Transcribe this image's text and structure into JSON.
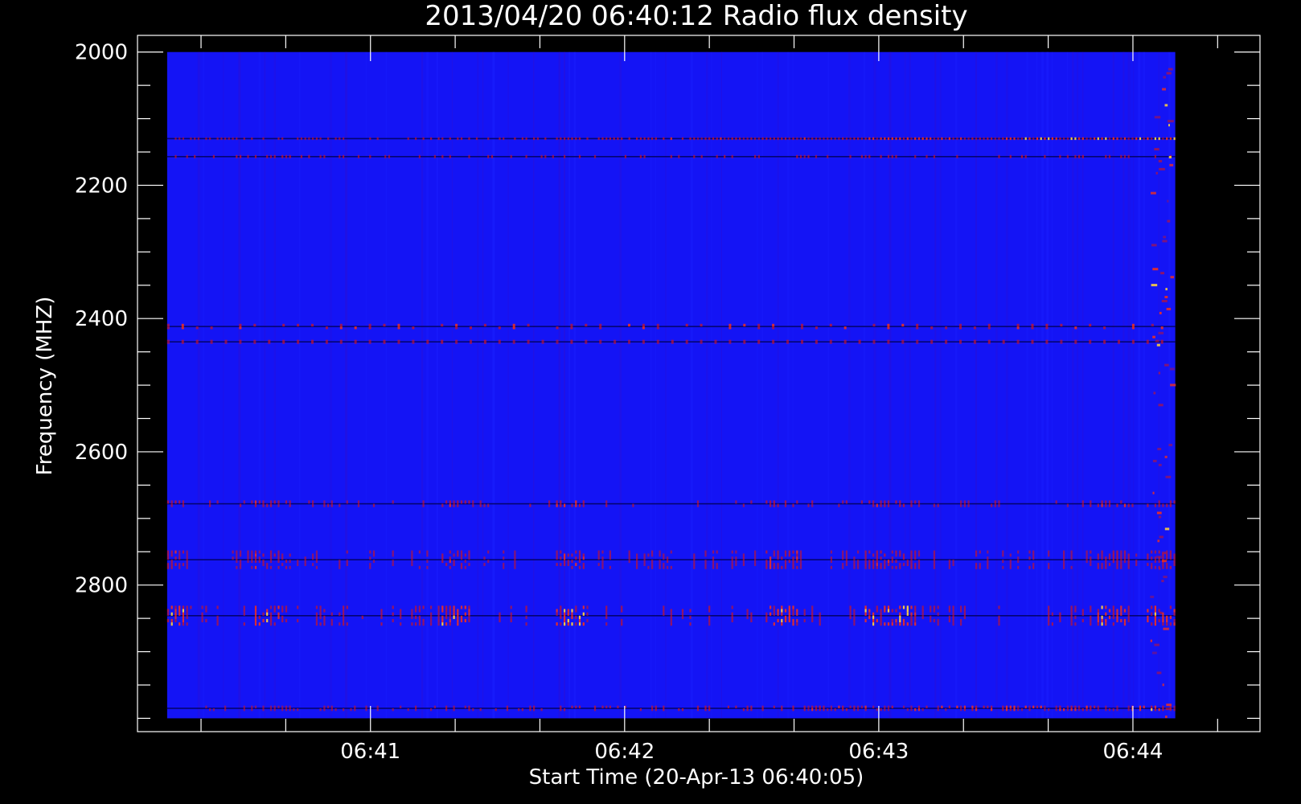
{
  "chart_data": {
    "type": "heatmap",
    "title": "2013/04/20 06:40:12 Radio flux density",
    "xlabel": "Start Time (20-Apr-13 06:40:05)",
    "ylabel": "Frequency (MHZ)",
    "x_range": [
      "06:40:05",
      "06:44:30"
    ],
    "y_range": [
      1975,
      3020
    ],
    "y_inverted": true,
    "data_time_range": [
      "06:40:12",
      "06:44:10"
    ],
    "data_freq_range": [
      2000,
      3000
    ],
    "x_ticks": [
      {
        "label": "06:41",
        "value": "06:41:00"
      },
      {
        "label": "06:42",
        "value": "06:42:00"
      },
      {
        "label": "06:43",
        "value": "06:43:00"
      },
      {
        "label": "06:44",
        "value": "06:44:00"
      }
    ],
    "x_minor_step_seconds": 20,
    "y_ticks": [
      {
        "label": "2000",
        "value": 2000
      },
      {
        "label": "2200",
        "value": 2200
      },
      {
        "label": "2400",
        "value": 2400
      },
      {
        "label": "2600",
        "value": 2600
      },
      {
        "label": "2800",
        "value": 2800
      }
    ],
    "y_minor_step": 50,
    "colors": {
      "background": "#000000",
      "axes": "#ffffff",
      "low": "#1414f5",
      "mid": "#c8142a",
      "high": "#ffd23c"
    },
    "emission_bands": [
      {
        "freq": 2130,
        "width": 4,
        "strength": 0.75,
        "pattern": "ramp-up"
      },
      {
        "freq": 2157,
        "width": 5,
        "strength": 0.4,
        "pattern": "patchy"
      },
      {
        "freq": 2412,
        "width": 8,
        "strength": 0.6,
        "pattern": "periodic"
      },
      {
        "freq": 2435,
        "width": 6,
        "strength": 0.35,
        "pattern": "periodic"
      },
      {
        "freq": 2678,
        "width": 10,
        "strength": 0.55,
        "pattern": "bursty"
      },
      {
        "freq": 2762,
        "width": 28,
        "strength": 0.5,
        "pattern": "bursty"
      },
      {
        "freq": 2846,
        "width": 30,
        "strength": 0.75,
        "pattern": "bursty"
      },
      {
        "freq": 2985,
        "width": 8,
        "strength": 0.65,
        "pattern": "ramp-up"
      }
    ]
  }
}
